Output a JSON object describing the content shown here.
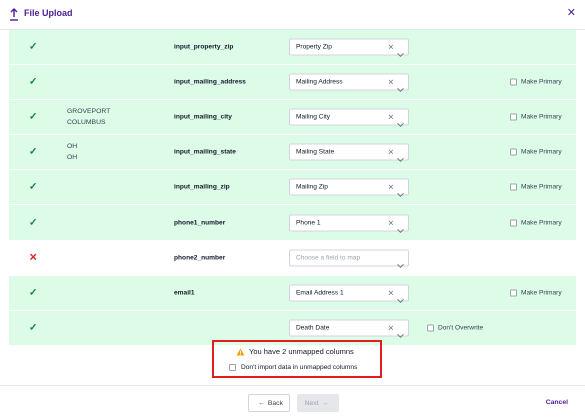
{
  "dialog": {
    "title": "File Upload",
    "close_icon": "close-icon",
    "upload_icon": "upload-icon"
  },
  "rows": [
    {
      "status": "mapped",
      "sample": [],
      "column": "input_property_zip",
      "field": "Property Zip",
      "has_clear": true,
      "option": ""
    },
    {
      "status": "mapped",
      "sample": [],
      "column": "input_mailing_address",
      "field": "Mailing Address",
      "has_clear": true,
      "option": "Make Primary"
    },
    {
      "status": "mapped",
      "sample": [
        "GROVEPORT",
        "COLUMBUS"
      ],
      "column": "input_mailing_city",
      "field": "Mailing City",
      "has_clear": true,
      "option": "Make Primary"
    },
    {
      "status": "mapped",
      "sample": [
        "OH",
        "OH"
      ],
      "column": "input_mailing_state",
      "field": "Mailing State",
      "has_clear": true,
      "option": "Make Primary"
    },
    {
      "status": "mapped",
      "sample": [],
      "column": "input_mailing_zip",
      "field": "Mailing Zip",
      "has_clear": true,
      "option": "Make Primary"
    },
    {
      "status": "mapped",
      "sample": [],
      "column": "phone1_number",
      "field": "Phone 1",
      "has_clear": true,
      "option": "Make Primary"
    },
    {
      "status": "unmapped",
      "sample": [],
      "column": "phone2_number",
      "field": "",
      "placeholder": "Choose a field to map",
      "has_clear": false,
      "option": ""
    },
    {
      "status": "mapped",
      "sample": [],
      "column": "email1",
      "field": "Email Address 1",
      "has_clear": true,
      "option": "Make Primary"
    },
    {
      "status": "mapped",
      "sample": [],
      "column": "",
      "field": "Death Date",
      "has_clear": true,
      "option": "Don't Overwrite"
    }
  ],
  "warning": {
    "text": "You have 2 unmapped columns",
    "checkbox_label": "Don't import data in unmapped columns",
    "color": "#e11d1d"
  },
  "footer": {
    "back_label": "Back",
    "next_label": "Next",
    "cancel_label": "Cancel"
  },
  "colors": {
    "mapped_bg": "#dcfce7",
    "accent": "#4c1d95",
    "check": "#15803d",
    "cross": "#dc2626"
  }
}
